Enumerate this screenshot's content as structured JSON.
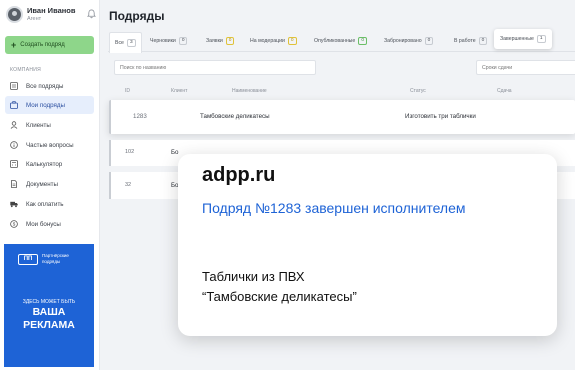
{
  "sidebar": {
    "user_name": "Иван Иванов",
    "user_role": "Агент",
    "create_button": "Создать подряд",
    "section_label": "КОМПАНИЯ",
    "items": [
      {
        "label": "Все подряды",
        "icon": "list-icon"
      },
      {
        "label": "Мои подряды",
        "icon": "briefcase-icon"
      },
      {
        "label": "Клиенты",
        "icon": "user-icon"
      },
      {
        "label": "Частые вопросы",
        "icon": "info-icon"
      },
      {
        "label": "Калькулятор",
        "icon": "calculator-icon"
      },
      {
        "label": "Документы",
        "icon": "document-icon"
      },
      {
        "label": "Как оплатить",
        "icon": "truck-icon"
      },
      {
        "label": "Мои бонусы",
        "icon": "coin-icon"
      }
    ],
    "ad": {
      "logo": "ПП",
      "logo_text": "Партнёрские подряды",
      "line1": "ЗДЕСЬ МОЖЕТ БЫТЬ",
      "line2": "ВАША",
      "line3": "РЕКЛАМА"
    }
  },
  "main": {
    "title": "Подряды",
    "tabs": [
      {
        "label": "Все",
        "count": "3"
      },
      {
        "label": "Черновики",
        "count": "0"
      },
      {
        "label": "Заявки",
        "count": "0"
      },
      {
        "label": "На модерации",
        "count": "0"
      },
      {
        "label": "Опубликованные",
        "count": "0"
      },
      {
        "label": "Забронировано",
        "count": "0"
      },
      {
        "label": "В работе",
        "count": "0"
      },
      {
        "label": "Завершенные",
        "count": "1"
      }
    ],
    "search_placeholder": "Поиск по названию",
    "deadline_placeholder": "Сроки сдачи",
    "columns": [
      "ID",
      "Клиент",
      "Наименование",
      "Статус",
      "Сдача"
    ],
    "rows": [
      {
        "id": "1283",
        "client": "Тамбовские деликатесы",
        "status": "Изготовить три таблички"
      },
      {
        "id": "102",
        "client": "Бо"
      },
      {
        "id": "32",
        "client": "Бо"
      }
    ]
  },
  "notification": {
    "brand": "adpp.ru",
    "title": "Подряд №1283 завершен исполнителем",
    "body_line1": "Таблички из ПВХ",
    "body_line2": "“Тамбовские деликатесы”"
  },
  "colors": {
    "accent_green": "#8ed68a",
    "accent_blue": "#1e63d6"
  }
}
